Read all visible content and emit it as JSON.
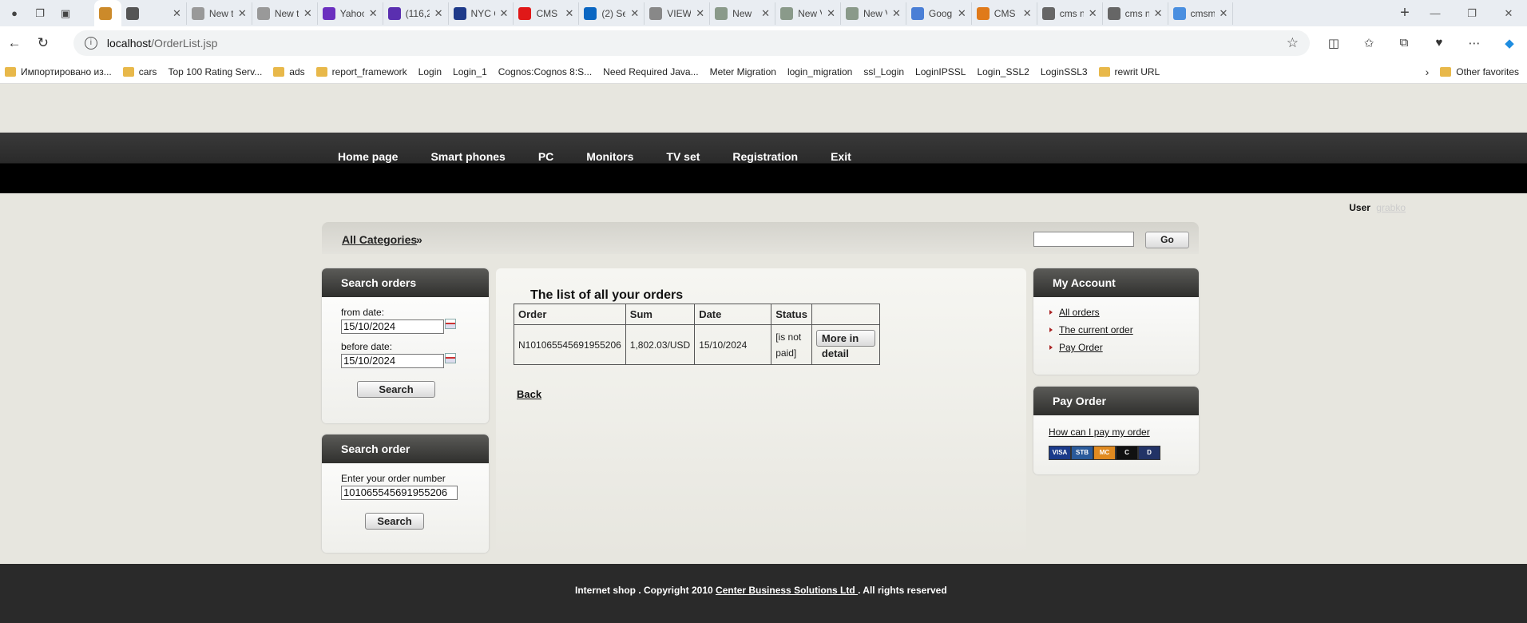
{
  "browser": {
    "tabs": [
      {
        "title": "",
        "active": true,
        "color": "#cc8a2a"
      },
      {
        "title": "",
        "color": "#555555"
      },
      {
        "title": "New t",
        "color": "#999999"
      },
      {
        "title": "New t",
        "color": "#999999"
      },
      {
        "title": "Yahoo",
        "color": "#6b2fbf"
      },
      {
        "title": "(116,2",
        "color": "#5a2fb0"
      },
      {
        "title": "NYC C",
        "color": "#1e3a8a"
      },
      {
        "title": "CMS",
        "color": "#e01818"
      },
      {
        "title": "(2) Se",
        "color": "#0a66c2"
      },
      {
        "title": "VIEW",
        "color": "#888888"
      },
      {
        "title": "New",
        "color": "#8a9a8a"
      },
      {
        "title": "New V",
        "color": "#8a9a8a"
      },
      {
        "title": "New V",
        "color": "#8a9a8a"
      },
      {
        "title": "Googl",
        "color": "#4a7fd6"
      },
      {
        "title": "CMS",
        "color": "#e07a1a"
      },
      {
        "title": "cms n",
        "color": "#666666"
      },
      {
        "title": "cms n",
        "color": "#666666"
      },
      {
        "title": "cmsm",
        "color": "#4a8fe0"
      }
    ],
    "url_host": "localhost",
    "url_path": "/OrderList.jsp",
    "bookmarks": [
      {
        "label": "Импортировано из...",
        "type": "folder"
      },
      {
        "label": "cars",
        "type": "folder"
      },
      {
        "label": "Top 100 Rating Serv...",
        "type": "page"
      },
      {
        "label": "ads",
        "type": "folder"
      },
      {
        "label": "report_framework",
        "type": "folder"
      },
      {
        "label": "Login",
        "type": "page"
      },
      {
        "label": "Login_1",
        "type": "page"
      },
      {
        "label": "Cognos:Cognos 8:S...",
        "type": "page"
      },
      {
        "label": "Need Required Java...",
        "type": "page"
      },
      {
        "label": "Meter Migration",
        "type": "page"
      },
      {
        "label": "login_migration",
        "type": "page"
      },
      {
        "label": "ssl_Login",
        "type": "page"
      },
      {
        "label": "LoginIPSSL",
        "type": "page"
      },
      {
        "label": "Login_SSL2",
        "type": "page"
      },
      {
        "label": "LoginSSL3",
        "type": "page"
      },
      {
        "label": "rewrit URL",
        "type": "folder"
      }
    ],
    "other_favorites": "Other favorites"
  },
  "menu": [
    "Home page",
    "Smart phones",
    "PC",
    "Monitors",
    "TV set",
    "Registration",
    "Exit"
  ],
  "user": {
    "label": "User",
    "name": "grabko"
  },
  "breadcrumb": {
    "label": "All Categories",
    "arrow": "»"
  },
  "top_search": {
    "value": "",
    "button": "Go"
  },
  "search_orders": {
    "title": "Search orders",
    "from_label": "from date:",
    "from_value": "15/10/2024",
    "before_label": "before date:",
    "before_value": "15/10/2024",
    "button": "Search"
  },
  "search_order": {
    "title": "Search order",
    "label": "Enter your order number",
    "value": "101065545691955206",
    "button": "Search"
  },
  "orders": {
    "title": "The list of all your orders",
    "columns": [
      "Order",
      "Sum",
      "Date",
      "Status",
      ""
    ],
    "rows": [
      {
        "order": "N101065545691955206",
        "sum": "1,802.03/USD",
        "date": "15/10/2024",
        "status": "[is not paid]",
        "action": "More in detail"
      }
    ],
    "back": "Back"
  },
  "my_account": {
    "title": "My Account",
    "links": [
      "All orders",
      "The current order",
      "Pay Order"
    ]
  },
  "pay_order": {
    "title": "Pay Order",
    "link": "How can I pay my order",
    "cards": [
      "VISA",
      "STB",
      "MC",
      "C",
      "D"
    ]
  },
  "footer": {
    "text_before": "Internet shop . Copyright 2010 ",
    "link": "Center Business Solutions Ltd ",
    "text_after": ". All rights reserved"
  }
}
